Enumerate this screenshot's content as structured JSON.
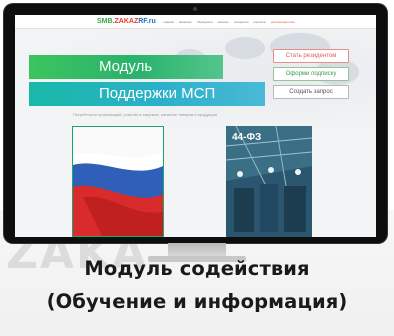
{
  "watermark": {
    "text": "ZAKA",
    "stamp": "3"
  },
  "site": {
    "logo_part_a": "SMB.",
    "logo_part_b": "ZAKAZ",
    "logo_part_c": "RF.ru",
    "nav": [
      "главная",
      "вакансии",
      "обращения",
      "магазин",
      "госзакупки",
      "контакты",
      "рекламодателям"
    ],
    "active_nav_index": 6
  },
  "banner": {
    "line1": "Модуль",
    "line2": "Поддержки МСП"
  },
  "cta": {
    "become_resident": "Стать резидентом",
    "subscribe": "Оформи подписку",
    "create_request": "Создать запрос"
  },
  "tagline": "Потребности организаций, участие в закупках, каталоге товаров и продукции",
  "cards": {
    "right_label": "44-ФЗ"
  },
  "caption": {
    "line1": "Модуль содействия",
    "line2": "(Обучение и информация)"
  },
  "colors": {
    "accent_green": "#2eb964",
    "accent_teal": "#21b3b8",
    "accent_red": "#e35d56"
  }
}
